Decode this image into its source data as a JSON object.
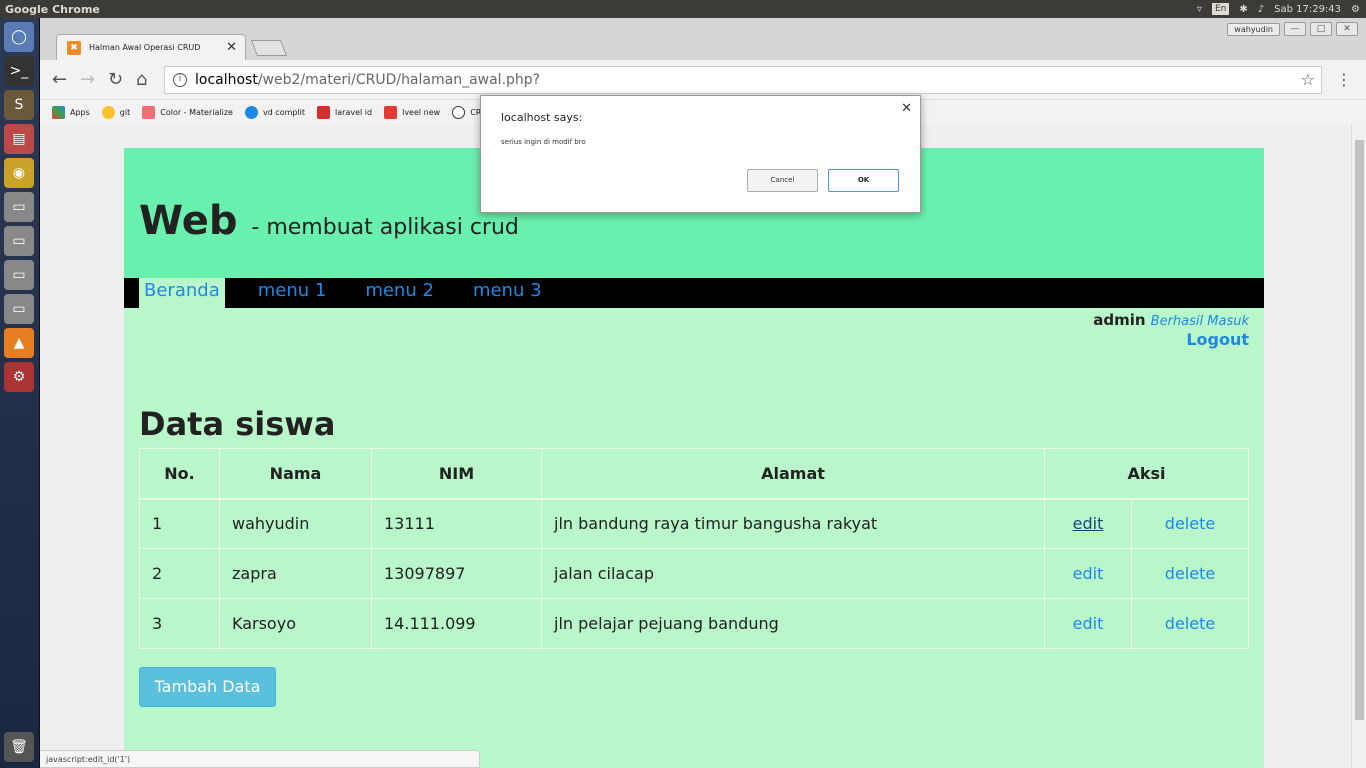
{
  "system": {
    "app_title": "Google Chrome",
    "lang": "En",
    "clock": "Sab 17:29:43"
  },
  "browser": {
    "tab_title": "Halman Awal Operasi CRUD",
    "user": "wahyudin",
    "url_host": "localhost",
    "url_path": "/web2/materi/CRUD/halaman_awal.php?",
    "bookmarks": [
      "Apps",
      "git",
      "Color - Materialize",
      "vd complit",
      "laravel id",
      "lveel new",
      "CR"
    ],
    "status_text": "javascript:edit_id('1')"
  },
  "dialog": {
    "title": "localhost says:",
    "message": "serius ingin di modif bro",
    "cancel_label": "Cancel",
    "ok_label": "OK"
  },
  "page": {
    "brand": "Web",
    "tagline": "- membuat aplikasi crud",
    "nav": [
      "Beranda",
      "menu 1",
      "menu 2",
      "menu 3"
    ],
    "username": "admin",
    "login_status": "Berhasil Masuk",
    "logout_label": "Logout",
    "section_title": "Data siswa",
    "table_headers": [
      "No.",
      "Nama",
      "NIM",
      "Alamat",
      "Aksi"
    ],
    "rows": [
      {
        "no": "1",
        "nama": "wahyudin",
        "nim": "13111",
        "alamat": "jln bandung raya timur bangusha rakyat",
        "edit": "edit",
        "delete": "delete"
      },
      {
        "no": "2",
        "nama": "zapra",
        "nim": "13097897",
        "alamat": "jalan cilacap",
        "edit": "edit",
        "delete": "delete"
      },
      {
        "no": "3",
        "nama": "Karsoyo",
        "nim": "14.111.099",
        "alamat": "jln pelajar pejuang bandung",
        "edit": "edit",
        "delete": "delete"
      }
    ],
    "add_button": "Tambah Data"
  },
  "colors": {
    "header_bg": "#69f0ae",
    "body_bg": "#b9f6ca",
    "link": "#1e88e5",
    "button": "#5bc0de"
  }
}
